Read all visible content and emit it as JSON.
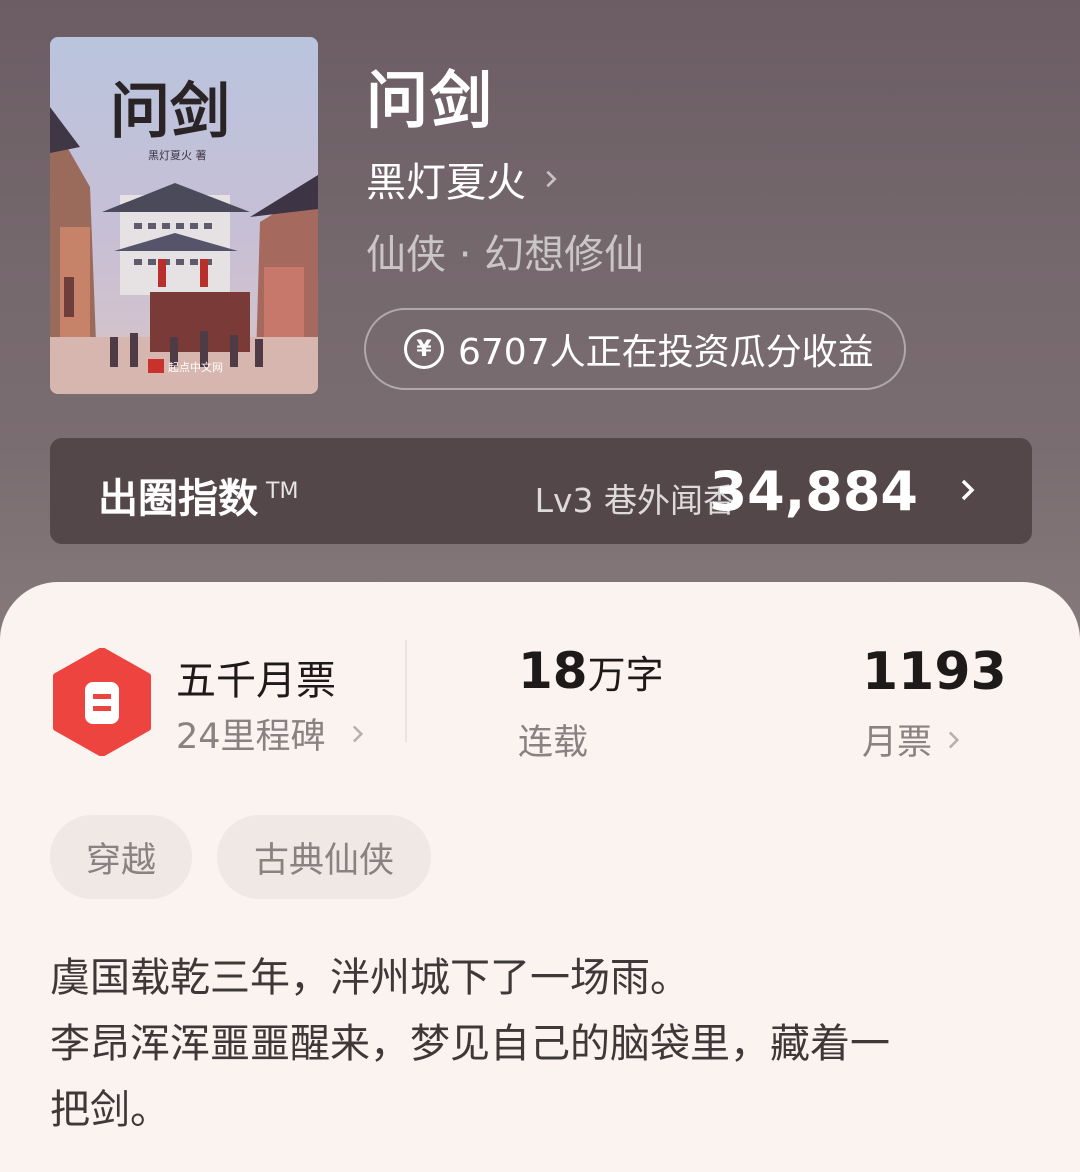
{
  "book": {
    "title": "问剑",
    "author": "黑灯夏火",
    "genre": "仙侠 · 幻想修仙",
    "investment": "6707人正在投资瓜分收益",
    "cover": {
      "title": "问剑",
      "author_line": "黑灯夏火 著",
      "publisher": "起点中文网"
    }
  },
  "index_bar": {
    "label": "出圈指数",
    "tm": "TM",
    "level": "Lv3 巷外闻香",
    "score": "34,884"
  },
  "stats": {
    "milestone_title": "五千月票",
    "milestone_sub": "24里程碑",
    "words_value": "18",
    "words_unit": "万字",
    "words_label": "连载",
    "tickets_value": "1193",
    "tickets_label": "月票"
  },
  "tags": [
    "穿越",
    "古典仙侠"
  ],
  "synopsis": {
    "line1": "虞国载乾三年，泮州城下了一场雨。",
    "line2": "李昂浑浑噩噩醒来，梦见自己的脑袋里，藏着一",
    "line3": "把剑。"
  },
  "colors": {
    "hero_bg": "#75686d",
    "index_bar_bg": "#53474a",
    "panel_bg": "#fbf3ef",
    "badge_red": "#ee4440"
  },
  "icons": [
    "chevron-right-icon",
    "yen-coin-icon",
    "ticket-badge-icon"
  ]
}
